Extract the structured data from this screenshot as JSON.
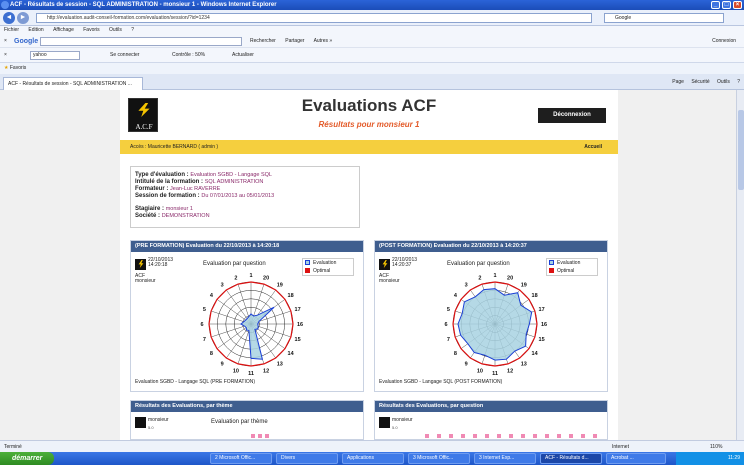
{
  "window": {
    "title": "ACF - Résultats de session - SQL ADMINISTRATION - monsieur 1 - Windows Internet Explorer"
  },
  "browser": {
    "url": "http://evaluation.audit-conseil-formation.com/evaluation/session/?id=1234",
    "search_placeholder": "Google",
    "menu": [
      "Fichier",
      "Edition",
      "Affichage",
      "Favoris",
      "Outils",
      "?"
    ],
    "google_items": [
      "Rechercher",
      "Partager",
      "Autres »"
    ],
    "google_label": "Google",
    "connexion": "Connexion",
    "yahoo_value": "yahoo",
    "yahoo_items": [
      "Se connecter",
      "Contrôle : 50%",
      "Actualiser"
    ],
    "favorites": "Favoris",
    "tab_label": "ACF - Résultats de session - SQL ADMINISTRATION ...",
    "cmds": [
      "Page",
      "Sécurité",
      "Outils",
      "?"
    ]
  },
  "page": {
    "logo_text": "A.C.F",
    "title": "Evaluations ACF",
    "subtitle": "Résultats pour monsieur 1",
    "logout": "Déconnexion",
    "access": "Accès : Mauricette BERNARD ( admin )",
    "home": "Accueil",
    "info": {
      "type_label": "Type d'évaluation :",
      "type_value": "Evaluation SGBD - Langage SQL",
      "course_label": "Intitulé de la formation :",
      "course_value": "SQL ADMINISTRATION",
      "trainer_label": "Formateur :",
      "trainer_value": "Jean-Luc RAVERRE",
      "session_label": "Session de formation :",
      "session_value": "Du 07/01/2013 au 05/01/2013",
      "trainee_label": "Stagiaire :",
      "trainee_value": "monsieur 1",
      "company_label": "Société :",
      "company_value": "DEMONSTRATION"
    },
    "pre": {
      "header": "(PRE FORMATION) Evaluation du 22/10/2013 à 14:20:18",
      "date": "22/10/2013",
      "time": "14:20:18",
      "logo_text": "ACF",
      "who": "monsieur",
      "chart_title": "Evaluation par question",
      "legend_eval": "Evaluation",
      "legend_opt": "Optimal",
      "footer": "Evaluation SGBD - Langage SQL (PRE FORMATION)"
    },
    "post": {
      "header": "(POST FORMATION) Evaluation du 22/10/2013 à 14:20:37",
      "date": "22/10/2013",
      "time": "14:20:37",
      "logo_text": "ACF",
      "who": "monsieur",
      "chart_title": "Evaluation par question",
      "legend_eval": "Evaluation",
      "legend_opt": "Optimal",
      "footer": "Evaluation SGBD - Langage SQL (POST FORMATION)"
    },
    "theme": {
      "header": "Résultats des Evaluations, par thème",
      "who": "monsieur",
      "chart_title": "Evaluation par thème",
      "tick": "5.0"
    },
    "question": {
      "header": "Résultats des Evaluations, par question",
      "who": "monsieur",
      "tick": "5.0"
    }
  },
  "status": {
    "left": "Terminé",
    "zone": "Internet",
    "zoom": "110%"
  },
  "taskbar": {
    "start": "démarrer",
    "items": [
      "2 Microsoft Offic...",
      "Divers",
      "Applications",
      "3 Microsoft Offic...",
      "3 Internet Exp...",
      "ACF - Résultats d...",
      "Acrobat ..."
    ],
    "active_index": 5,
    "clock": "11:29"
  },
  "chart_data": [
    {
      "type": "radar",
      "title": "Evaluation par question",
      "categories": [
        "1",
        "20",
        "19",
        "18",
        "17",
        "16",
        "15",
        "14",
        "13",
        "12",
        "11",
        "10",
        "9",
        "8",
        "7",
        "6",
        "5",
        "4",
        "3",
        "2"
      ],
      "series": [
        {
          "name": "Evaluation",
          "values": [
            1.2,
            1.0,
            1.3,
            3.4,
            1.0,
            0.8,
            0.9,
            1.0,
            0.8,
            4.4,
            4.1,
            0.8,
            0.9,
            0.7,
            0.8,
            1.2,
            0.9,
            0.8,
            0.8,
            0.9
          ]
        },
        {
          "name": "Optimal",
          "values": [
            5,
            5,
            5,
            5,
            5,
            5,
            5,
            5,
            5,
            5,
            5,
            5,
            5,
            5,
            5,
            5,
            5,
            5,
            5,
            5
          ]
        }
      ],
      "rmax": 5
    },
    {
      "type": "radar",
      "title": "Evaluation par question",
      "categories": [
        "1",
        "20",
        "19",
        "18",
        "17",
        "16",
        "15",
        "14",
        "13",
        "12",
        "11",
        "10",
        "9",
        "8",
        "7",
        "6",
        "5",
        "4",
        "3",
        "2"
      ],
      "series": [
        {
          "name": "Evaluation",
          "values": [
            4.2,
            3.6,
            4.6,
            3.8,
            4.6,
            4.1,
            3.9,
            4.5,
            4.0,
            4.4,
            4.3,
            3.9,
            4.2,
            4.0,
            4.3,
            4.4,
            4.1,
            4.5,
            4.0,
            4.3
          ]
        },
        {
          "name": "Optimal",
          "values": [
            5,
            5,
            5,
            5,
            5,
            5,
            5,
            5,
            5,
            5,
            5,
            5,
            5,
            5,
            5,
            5,
            5,
            5,
            5,
            5
          ]
        }
      ],
      "rmax": 5
    }
  ],
  "colors": {
    "eval_fill": "#a8d2e2",
    "eval_stroke": "#1a3fd6",
    "optimal": "#dd1111",
    "header_bg": "#3f5e8f",
    "accent": "#e35b2a",
    "yellow": "#f5cf3e"
  }
}
